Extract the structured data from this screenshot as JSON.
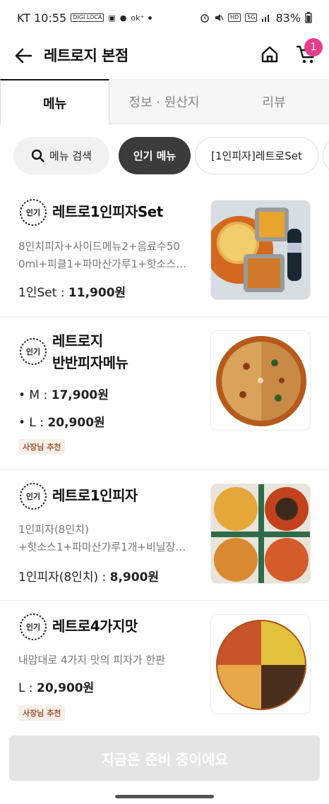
{
  "status_bar": {
    "carrier_time": "KT 10:55",
    "icons_left": [
      "DIGI LOCA",
      "▣",
      "●",
      "ok⁺"
    ],
    "net_label": "HD",
    "signal_label": "5G",
    "battery": "83%"
  },
  "header": {
    "title": "레트로지 본점",
    "cart_count": "1"
  },
  "tabs": [
    {
      "label": "메뉴",
      "active": true
    },
    {
      "label": "정보 · 원산지",
      "active": false
    },
    {
      "label": "리뷰",
      "active": false
    }
  ],
  "chips": {
    "search": "메뉴 검색",
    "popular": "인기 메뉴",
    "set": "[1인피자]레트로Set"
  },
  "badge_label": "인기",
  "items": [
    {
      "title": "레트로1인피자Set",
      "desc_lines": [
        "8인치피자+사이드메뉴2+음료수50",
        "0ml+피클1+파마산가루1+핫소스…"
      ],
      "prices": [
        {
          "label": "1인Set : ",
          "value": "11,900원"
        }
      ]
    },
    {
      "title_lines": [
        "레트로지",
        "반반피자메뉴"
      ],
      "prices": [
        {
          "label": "• M : ",
          "value": "17,900원"
        },
        {
          "label": "• L : ",
          "value": "20,900원"
        }
      ],
      "tag": "사장님 추천"
    },
    {
      "title": "레트로1인피자",
      "desc_lines": [
        "1인피자(8인치)",
        "+핫소스1+파마산가루1개+비닐장…"
      ],
      "prices": [
        {
          "label": "1인피자(8인치) : ",
          "value": "8,900원"
        }
      ]
    },
    {
      "title": "레트로4가지맛",
      "desc_lines": [
        "내맘대로 4가지 맛의 피자가 한판"
      ],
      "prices": [
        {
          "label": "L : ",
          "value": "20,900원"
        }
      ],
      "tag": "사장님 추천"
    }
  ],
  "order_button": "지금은 준비 중이에요",
  "colors": {
    "accent_badge": "#e63e8c",
    "chip_active": "#3b3b3b",
    "tag_text": "#a0583a"
  }
}
